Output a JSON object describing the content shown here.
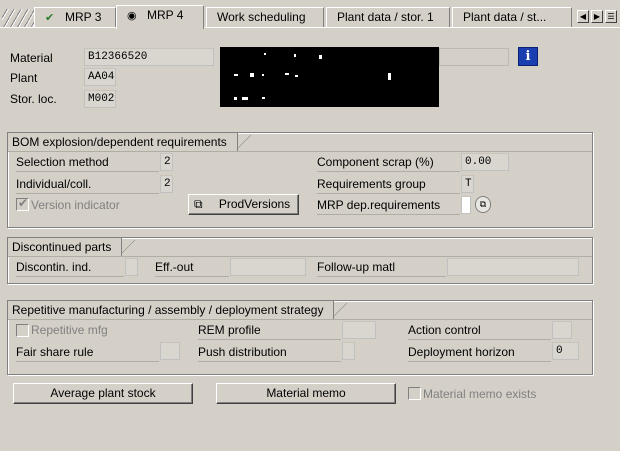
{
  "tabs": [
    {
      "label": "MRP 3",
      "icon": "check-icon"
    },
    {
      "label": "MRP 4",
      "icon": "eye-icon"
    },
    {
      "label": "Work scheduling"
    },
    {
      "label": "Plant data / stor. 1"
    },
    {
      "label": "Plant data / st..."
    }
  ],
  "header": {
    "material_label": "Material",
    "material_value": "B12366520",
    "plant_label": "Plant",
    "plant_value": "AA04",
    "storloc_label": "Stor. loc.",
    "storloc_value": "M002"
  },
  "bom": {
    "title": "BOM explosion/dependent requirements",
    "selection_method_label": "Selection method",
    "selection_method_value": "2",
    "individual_coll_label": "Individual/coll.",
    "individual_coll_value": "2",
    "version_indicator_label": "Version indicator",
    "version_indicator_checked": true,
    "prodversions_label": "ProdVersions",
    "component_scrap_label": "Component scrap (%)",
    "component_scrap_value": "0.00",
    "req_group_label": "Requirements group",
    "req_group_value": "T",
    "mrp_dep_label": "MRP dep.requirements",
    "mrp_dep_value": ""
  },
  "discontinued": {
    "title": "Discontinued parts",
    "discontin_label": "Discontin. ind.",
    "eff_out_label": "Eff.-out",
    "followup_label": "Follow-up matl"
  },
  "repetitive": {
    "title": "Repetitive manufacturing / assembly / deployment strategy",
    "rep_mfg_label": "Repetitive mfg",
    "rem_profile_label": "REM profile",
    "action_control_label": "Action control",
    "fair_share_label": "Fair share rule",
    "push_dist_label": "Push distribution",
    "deploy_horizon_label": "Deployment horizon",
    "deploy_horizon_value": "0"
  },
  "footer": {
    "avg_stock_label": "Average plant stock",
    "material_memo_label": "Material memo",
    "memo_exists_label": "Material memo exists"
  },
  "colors": {
    "background": "#d4d0c8",
    "info_icon": "#1a3fb0"
  }
}
